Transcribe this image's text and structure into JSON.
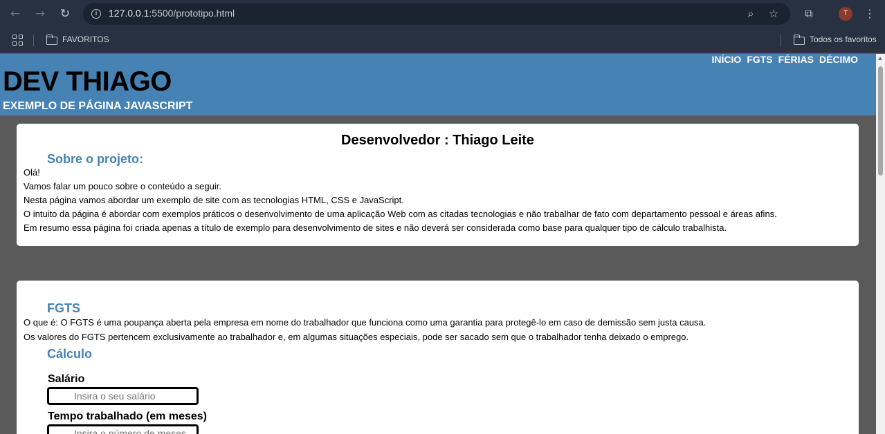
{
  "browser": {
    "url_host": "127.0.0.1",
    "url_path": ":5500/prototipo.html",
    "avatar_letter": "T",
    "bookmarks": {
      "favoritos": "FAVORITOS",
      "todos_favoritos": "Todos os favoritos"
    }
  },
  "site": {
    "title": "DEV THIAGO",
    "subtitle": "EXEMPLO DE PÁGINA JAVASCRIPT",
    "nav": [
      "INÍCIO",
      "FGTS",
      "FÉRIAS",
      "DÉCIMO"
    ]
  },
  "about": {
    "heading": "Desenvolvedor : Thiago Leite",
    "title": "Sobre o projeto:",
    "lines": [
      "Olá!",
      "Vamos falar um pouco sobre o conteúdo a seguir.",
      "Nesta página vamos abordar um exemplo de site com as tecnologias HTML, CSS e JavaScript.",
      "O intuito da página é abordar com exemplos práticos o desenvolvimento de uma aplicação Web com as citadas tecnologias e não trabalhar de fato com departamento pessoal e áreas afins.",
      "Em resumo essa página foi criada apenas a título de exemplo para desenvolvimento de sites e não deverá ser considerada como base para qualquer tipo de cálculo trabalhista."
    ]
  },
  "fgts": {
    "title": "FGTS",
    "lines": [
      "O que é: O FGTS é uma poupança aberta pela empresa em nome do trabalhador que funciona como uma garantia para protegê-lo em caso de demissão sem justa causa.",
      "Os valores do FGTS pertencem exclusivamente ao trabalhador e, em algumas situações especiais, pode ser sacado sem que o trabalhador tenha deixado o emprego."
    ],
    "calc_title": "Cálculo",
    "salary_label": "Salário",
    "salary_placeholder": "Insira o seu salário",
    "months_label": "Tempo trabalhado (em meses)",
    "months_placeholder": "Insira o número de meses"
  }
}
